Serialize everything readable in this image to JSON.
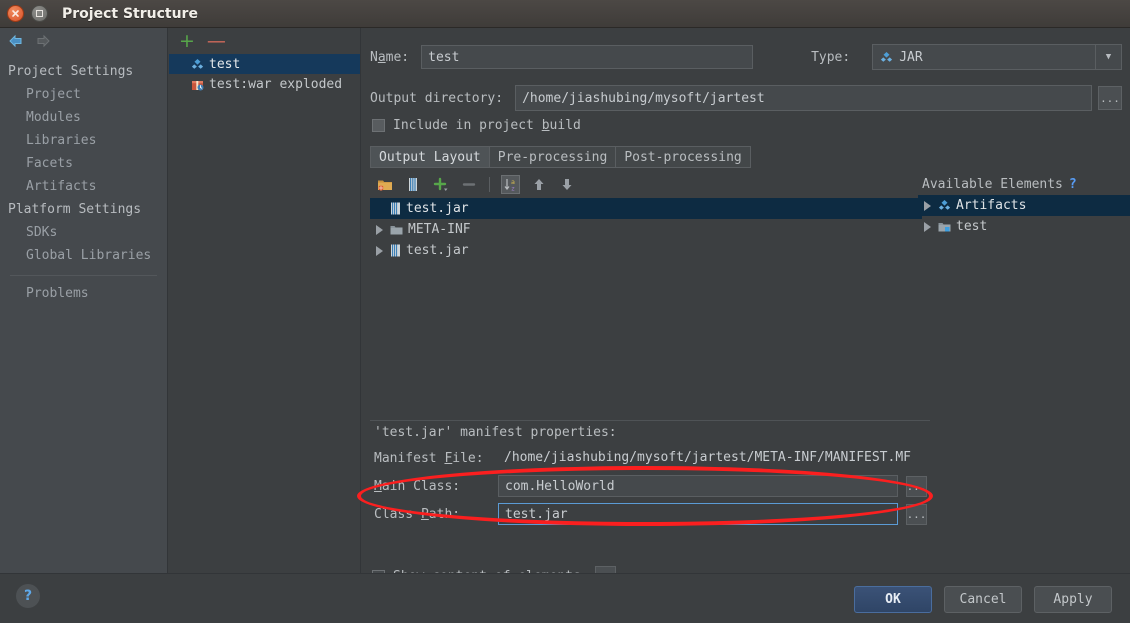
{
  "window": {
    "title": "Project Structure",
    "close_icon": "close-icon",
    "maximize_icon": "maximize-icon"
  },
  "nav": {
    "back_icon": "back-arrow-icon",
    "forward_icon": "forward-arrow-icon"
  },
  "sidebar": {
    "items": [
      {
        "label": "Project Settings",
        "type": "group"
      },
      {
        "label": "Project",
        "type": "sub"
      },
      {
        "label": "Modules",
        "type": "sub"
      },
      {
        "label": "Libraries",
        "type": "sub"
      },
      {
        "label": "Facets",
        "type": "sub"
      },
      {
        "label": "Artifacts",
        "type": "sub"
      },
      {
        "label": "Platform Settings",
        "type": "group"
      },
      {
        "label": "SDKs",
        "type": "sub"
      },
      {
        "label": "Global Libraries",
        "type": "sub"
      },
      {
        "label": "Problems",
        "type": "sub"
      }
    ]
  },
  "artifacts_panel": {
    "add_label": "+",
    "remove_label": "—",
    "items": [
      {
        "label": "test",
        "icon": "jar-artifact-icon",
        "selected": true
      },
      {
        "label": "test:war exploded",
        "icon": "war-artifact-icon",
        "selected": false
      }
    ]
  },
  "form": {
    "name_label": "Name:",
    "name_value": "test",
    "type_label": "Type:",
    "type_value": "JAR",
    "output_dir_label": "Output directory:",
    "output_dir_value": "/home/jiashubing/mysoft/jartest",
    "browse_label": "...",
    "include_in_build_label": "Include in project build",
    "include_in_build_checked": false
  },
  "tabs": [
    {
      "label": "Output Layout",
      "active": true
    },
    {
      "label": "Pre-processing",
      "active": false
    },
    {
      "label": "Post-processing",
      "active": false
    }
  ],
  "tree_toolbar": {
    "buttons": [
      {
        "icon": "add-directory-icon",
        "pressed": false
      },
      {
        "icon": "add-archive-icon",
        "pressed": false
      },
      {
        "icon": "add-icon",
        "pressed": false
      },
      {
        "icon": "remove-icon",
        "pressed": false
      },
      {
        "icon": "sort-alphabetically-icon",
        "pressed": true
      },
      {
        "icon": "move-up-icon",
        "pressed": false
      },
      {
        "icon": "move-down-icon",
        "pressed": false
      }
    ]
  },
  "output_tree": {
    "nodes": [
      {
        "label": "test.jar",
        "icon": "jar-icon",
        "selected": true,
        "expandable": false
      },
      {
        "label": "META-INF",
        "icon": "folder-icon",
        "selected": false,
        "expandable": true
      },
      {
        "label": "test.jar",
        "icon": "jar-icon",
        "selected": false,
        "expandable": true
      }
    ]
  },
  "available_elements": {
    "title": "Available Elements",
    "help_label": "?",
    "nodes": [
      {
        "label": "Artifacts",
        "icon": "artifacts-icon",
        "selected": true,
        "expandable": true
      },
      {
        "label": "test",
        "icon": "module-icon",
        "selected": false,
        "expandable": true
      }
    ]
  },
  "manifest": {
    "title": "'test.jar' manifest properties:",
    "manifest_file_label": "Manifest File:",
    "manifest_file_value": "/home/jiashubing/mysoft/jartest/META-INF/MANIFEST.MF",
    "main_class_label": "Main Class:",
    "main_class_value": "com.HelloWorld",
    "class_path_label": "Class Path:",
    "class_path_value": "test.jar",
    "browse_label": "..."
  },
  "show_content": {
    "label": "Show content of elements",
    "checked": true,
    "browse_label": "..."
  },
  "footer": {
    "help_label": "?",
    "ok_label": "OK",
    "cancel_label": "Cancel",
    "apply_label": "Apply"
  },
  "colors": {
    "background": "#3c3f41",
    "sidebar_background": "#45494d",
    "selection_blue": "#0d2b42",
    "artifact_selection": "#15395b",
    "accent_blue": "#589df6",
    "annotation_red": "#fb1f1f",
    "add_green": "#57a64a",
    "remove_red": "#cf6a5a"
  }
}
